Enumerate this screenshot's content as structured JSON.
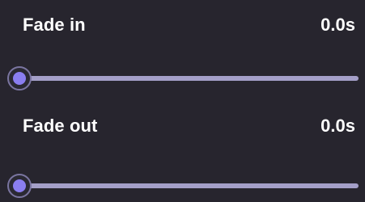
{
  "theme": {
    "background": "#27252e",
    "text": "#ffffff",
    "accent": "#8a7ef0",
    "track": "#a49fc8"
  },
  "fade_in": {
    "label": "Fade in",
    "value_text": "0.0s",
    "value": 0.0,
    "slider_fraction": 0.0
  },
  "fade_out": {
    "label": "Fade out",
    "value_text": "0.0s",
    "value": 0.0,
    "slider_fraction": 0.0
  }
}
